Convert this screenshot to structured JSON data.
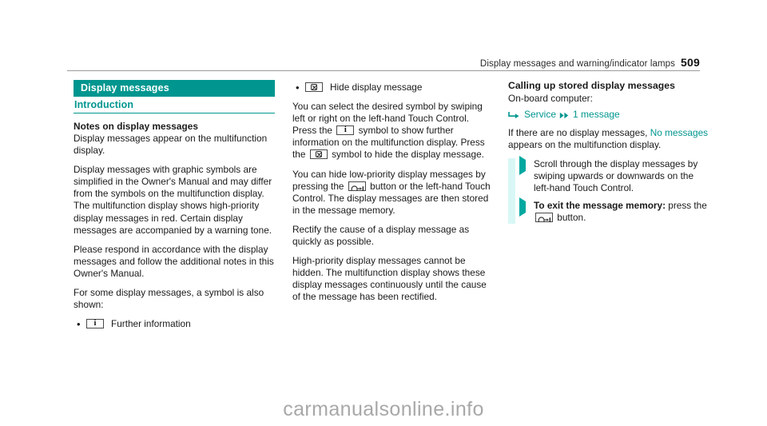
{
  "header": {
    "title": "Display messages and warning/indicator lamps",
    "page_number": "509"
  },
  "colors": {
    "accent_teal": "#00968f",
    "bullet_teal": "#00a8a0",
    "band_teal": "#d8f7f5",
    "watermark_gray": "#a8a8a8"
  },
  "column_left": {
    "section_title": "Display messages",
    "subsection_title": "Introduction",
    "heading": "Notes on display messages",
    "paragraphs": [
      "Display messages appear on the multifunction display.",
      "Display messages with graphic symbols are simplified in the Owner's Manual and may differ from the symbols on the multifunction display. The multifunction display shows high-priority display messages in red. Certain display messages are accompanied by a warning tone.",
      "Please respond in accordance with the display messages and follow the additional notes in this Owner's Manual.",
      "For some display messages, a symbol is also shown:"
    ],
    "bullet": {
      "marker": "•",
      "icon": "info-i-icon",
      "label": "Further information"
    }
  },
  "column_middle": {
    "bullet": {
      "marker": "•",
      "icon": "hide-message-icon",
      "label": "Hide display message"
    },
    "para_1_part1": "You can select the desired symbol by swiping left or right on the left-hand Touch Control. Press the",
    "para_1_part2": "symbol to show further information on the multifunction display. Press the",
    "para_1_part3": "symbol to hide the display message.",
    "para_2_part1": "You can hide low-priority display messages by pressing the",
    "para_2_part2": "button or the left-hand Touch Control. The display messages are then stored in the message memory.",
    "para_3": "Rectify the cause of a display message as quickly as possible.",
    "para_4": "High-priority display messages cannot be hidden. The multifunction display shows these display messages continuously until the cause of the message has been rectified."
  },
  "column_right": {
    "heading": "Calling up stored display messages",
    "subheading": "On-board computer:",
    "breadcrumb": {
      "first_arrow": "corner-arrow-icon",
      "item_1": "Service",
      "second_arrow": "double-arrow-icon",
      "item_2": "1 message"
    },
    "para_1_part1": "If there are no display messages,",
    "para_1_highlight": "No messages",
    "para_1_part2": "appears on the multifunction display.",
    "steps": [
      {
        "marker": "triangle-bullet-icon",
        "bold": "",
        "text": "Scroll through the display messages by swiping upwards or downwards on the left-hand Touch Control."
      },
      {
        "marker": "triangle-bullet-icon",
        "bold": "To exit the message memory:",
        "text": "press the",
        "icon": "back-button-icon",
        "text_after": "button."
      }
    ]
  },
  "watermark": {
    "text": "carmanualsonline.info"
  }
}
